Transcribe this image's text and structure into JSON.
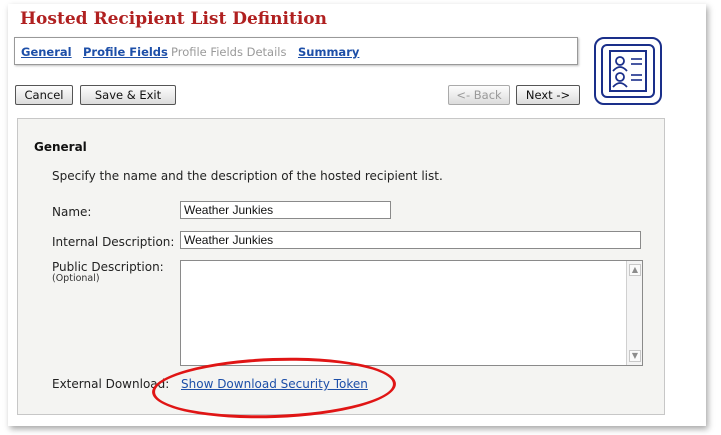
{
  "page": {
    "title": "Hosted Recipient List Definition"
  },
  "tabs": [
    {
      "label": "General",
      "state": "active"
    },
    {
      "label": "Profile Fields",
      "state": "link"
    },
    {
      "label": "Profile Fields Details",
      "state": "disabled"
    },
    {
      "label": "Summary",
      "state": "link"
    }
  ],
  "toolbar": {
    "cancel_label": "Cancel",
    "save_exit_label": "Save & Exit",
    "back_label": "<- Back",
    "next_label": "Next ->"
  },
  "logo": {
    "icon": "recipient-list-icon",
    "color": "#1a2f8a"
  },
  "section": {
    "title": "General",
    "description": "Specify the name and the description of the hosted recipient list."
  },
  "form": {
    "name_label": "Name:",
    "name_value": "Weather Junkies",
    "internal_label": "Internal Description:",
    "internal_value": "Weather Junkies",
    "public_label": "Public Description:",
    "public_sublabel": "(Optional)",
    "public_value": "",
    "download_label": "External Download:",
    "download_link": "Show Download Security Token"
  },
  "colors": {
    "title": "#b02020",
    "link": "#1d4fa8",
    "highlight": "#e01515"
  }
}
